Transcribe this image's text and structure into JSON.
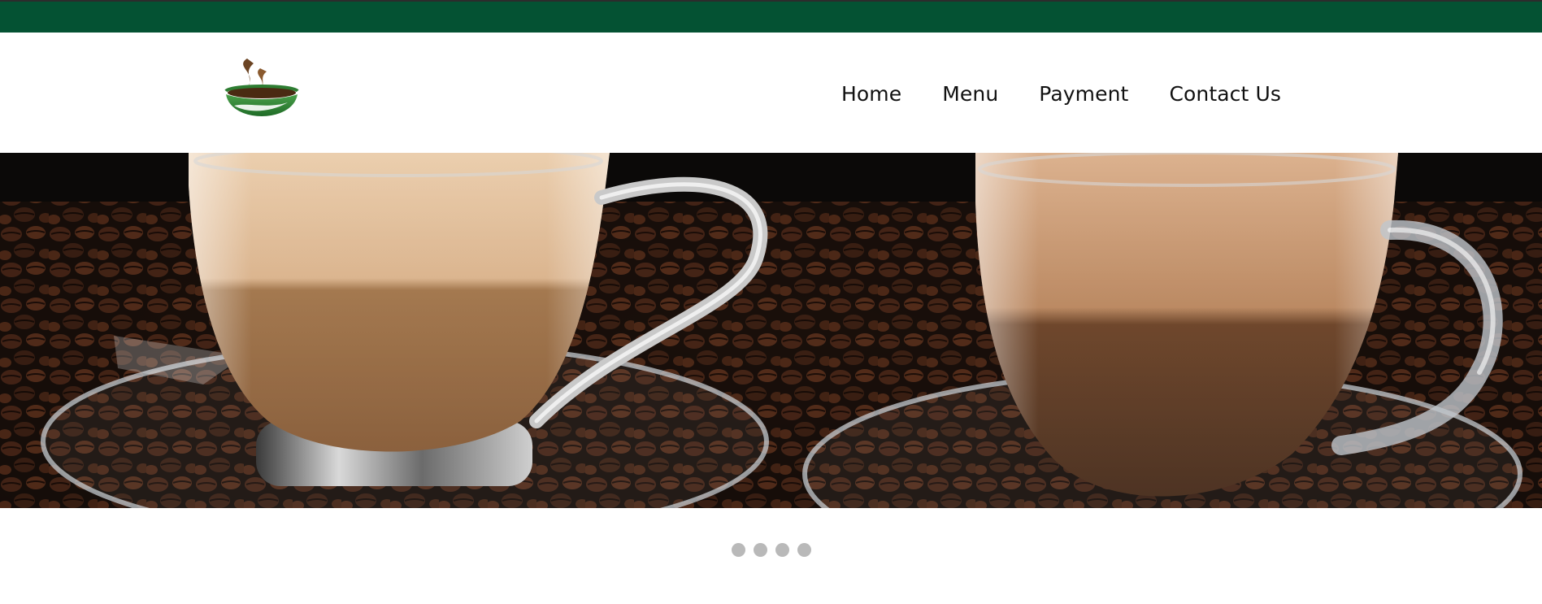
{
  "brand": {
    "logo_icon": "coffee-cup-logo-icon",
    "primary_color": "#045233"
  },
  "nav": {
    "items": [
      {
        "label": "Home"
      },
      {
        "label": "Menu"
      },
      {
        "label": "Payment"
      },
      {
        "label": "Contact Us"
      }
    ]
  },
  "hero": {
    "image": "two-glass-coffee-cups-on-beans"
  },
  "carousel": {
    "slide_count": 4
  }
}
